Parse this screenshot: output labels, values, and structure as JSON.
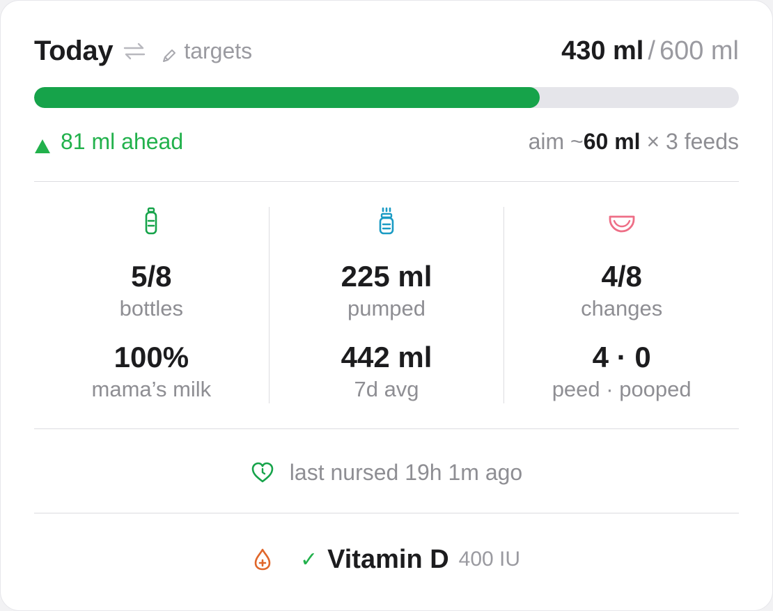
{
  "header": {
    "title": "Today",
    "targets_label": "targets",
    "total_current": "430 ml",
    "total_separator": "/",
    "total_target": "600 ml"
  },
  "progress": {
    "fraction": 0.717,
    "color": "#16a34a"
  },
  "status": {
    "ahead_text": "81 ml ahead",
    "aim_prefix": "aim ~",
    "aim_amount": "60 ml",
    "aim_suffix": "× 3 feeds"
  },
  "stats": [
    {
      "icon": "bottle-icon",
      "value1": "5/8",
      "label1": "bottles",
      "value2": "100%",
      "label2": "mama’s milk"
    },
    {
      "icon": "pump-icon",
      "value1": "225 ml",
      "label1": "pumped",
      "value2": "442 ml",
      "label2": "7d avg"
    },
    {
      "icon": "diaper-icon",
      "value1": "4/8",
      "label1": "changes",
      "value2": "4 · 0",
      "label2": "peed · pooped"
    }
  ],
  "nursing": {
    "text": "last nursed 19h 1m ago"
  },
  "vitamin": {
    "check": "✓",
    "name": "Vitamin D",
    "dose": "400 IU"
  },
  "colors": {
    "green": "#16a34a",
    "light_green": "#22b14c",
    "teal": "#1a9bc4",
    "pink": "#ee6e86",
    "orange": "#e0662a"
  }
}
